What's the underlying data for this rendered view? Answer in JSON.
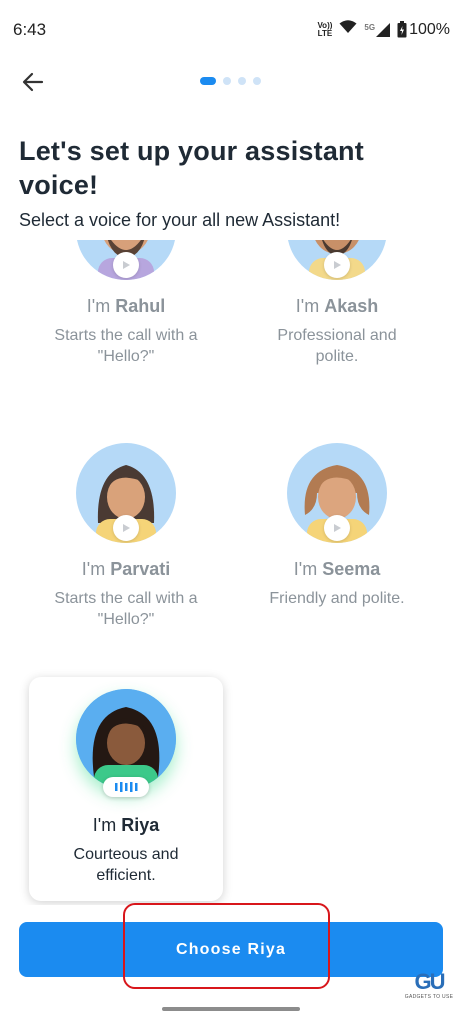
{
  "status_bar": {
    "time": "6:43",
    "volte_top": "Vo))",
    "volte_bottom": "LTE",
    "network": "5G",
    "battery": "100%"
  },
  "header": {
    "back_icon": "arrow-left-icon",
    "pager_total": 4,
    "pager_active": 1
  },
  "title": "Let's set up your assistant voice!",
  "subtitle": "Select a voice for your all new Assistant!",
  "voices": [
    {
      "prefix": "I'm ",
      "name": "Rahul",
      "desc_line1": "Starts the call with a",
      "desc_line2": "\"Hello?\""
    },
    {
      "prefix": "I'm ",
      "name": "Akash",
      "desc_line1": "Professional and",
      "desc_line2": "polite."
    },
    {
      "prefix": "I'm ",
      "name": "Parvati",
      "desc_line1": "Starts the call with a",
      "desc_line2": "\"Hello?\""
    },
    {
      "prefix": "I'm ",
      "name": "Seema",
      "desc_line1": "Friendly and polite.",
      "desc_line2": ""
    },
    {
      "prefix": "I'm ",
      "name": "Riya",
      "desc_line1": "Courteous and",
      "desc_line2": "efficient.",
      "selected": true
    }
  ],
  "cta": {
    "label": "Choose Riya"
  },
  "watermark": {
    "logo": "GU",
    "text": "GADGETS TO USE"
  },
  "colors": {
    "accent": "#1b8bf0",
    "highlight": "#d8161b",
    "text": "#1f2a35",
    "muted": "#8b939a"
  }
}
